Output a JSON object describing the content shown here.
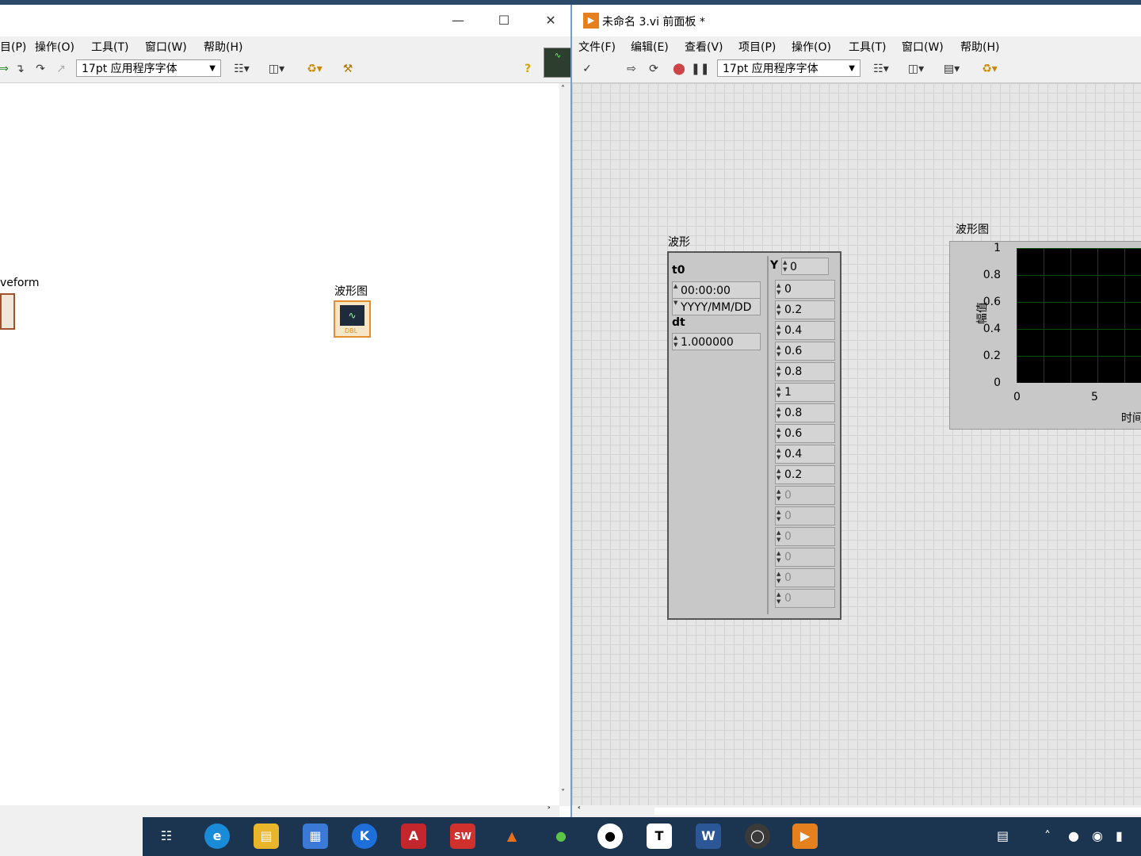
{
  "left_window": {
    "menus": [
      "目(P)",
      "操作(O)",
      "工具(T)",
      "窗口(W)",
      "帮助(H)"
    ],
    "font_select": "17pt 应用程序字体",
    "help_icon": "?",
    "nodes": {
      "waveform_label": "veform",
      "graph_label": "波形图",
      "graph_type": "DBL"
    }
  },
  "right_window": {
    "title": "未命名 3.vi 前面板 *",
    "menus": [
      "文件(F)",
      "编辑(E)",
      "查看(V)",
      "项目(P)",
      "操作(O)",
      "工具(T)",
      "窗口(W)",
      "帮助(H)"
    ],
    "font_select": "17pt 应用程序字体",
    "waveform_control": {
      "label": "波形",
      "t0_label": "t0",
      "t0_time": "00:00:00",
      "t0_date": "YYYY/MM/DD",
      "dt_label": "dt",
      "dt_value": "1.000000",
      "y_label": "Y",
      "y_index": "0",
      "y_values": [
        "0",
        "0.2",
        "0.4",
        "0.6",
        "0.8",
        "1",
        "0.8",
        "0.6",
        "0.4",
        "0.2"
      ],
      "y_empty": [
        "0",
        "0",
        "0",
        "0",
        "0",
        "0"
      ]
    },
    "graph": {
      "label": "波形图",
      "ylabel": "幅值",
      "xlabel": "时间",
      "yticks": [
        "1",
        "0.8",
        "0.6",
        "0.4",
        "0.2",
        "0"
      ],
      "xticks": [
        "0",
        "5"
      ]
    }
  },
  "taskbar": {
    "apps": [
      "task-view",
      "edge",
      "explorer",
      "store",
      "k-app",
      "autocad",
      "solidworks",
      "matlab",
      "wechat",
      "qq",
      "typora",
      "word",
      "obs",
      "labview"
    ],
    "labels": {
      "autocad": "A",
      "solidworks": "SW",
      "typora": "T",
      "word": "W",
      "k": "K"
    }
  }
}
